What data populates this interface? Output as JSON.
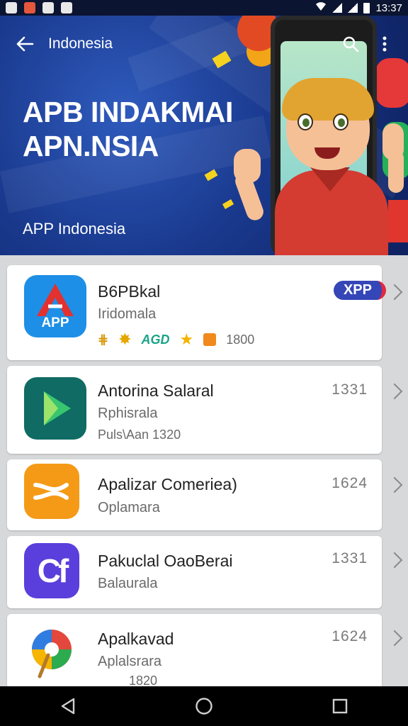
{
  "status_bar": {
    "time": "13:37"
  },
  "header": {
    "nav_title": "Indonesia",
    "headline_line1": "APB INDAKMAI",
    "headline_line2": "APN.NSIA",
    "subtitle": "APP Indonesia"
  },
  "apps": [
    {
      "name": "B6PBkal",
      "subtitle": "Iridomala",
      "icon_label": "APP",
      "badge": "XPP",
      "rating_text": "AGD",
      "rating_count": "1800",
      "colors": {
        "icon_bg": "#1e8fe6",
        "accent": "#e2312f"
      }
    },
    {
      "name": "Antorina Salaral",
      "subtitle": "Rphisrala",
      "meta": "Puls\\Aan 1320",
      "count": "1331",
      "colors": {
        "icon_bg": "#0f6b63",
        "accent": "#38c56f"
      }
    },
    {
      "name": "Apalizar Comeriea)",
      "subtitle": "Oplamara",
      "count": "1624",
      "colors": {
        "icon_bg": "#f59a16",
        "accent": "#ffffff"
      }
    },
    {
      "name": "Pakuclal OaoBerai",
      "subtitle": "Balaurala",
      "icon_label": "Cf",
      "count": "1331",
      "colors": {
        "icon_bg": "#5a3fdc",
        "accent": "#ffffff"
      }
    },
    {
      "name": "Apalkavad",
      "subtitle": "Aplalsrara",
      "meta": "1820",
      "count": "1624",
      "colors": {
        "icon_bg": "#ffffff",
        "accent": "#e4473b"
      }
    }
  ],
  "icons": {
    "back": "arrow-left-icon",
    "search": "search-icon",
    "more": "more-vertical-icon",
    "chevron": "chevron-right-icon"
  }
}
